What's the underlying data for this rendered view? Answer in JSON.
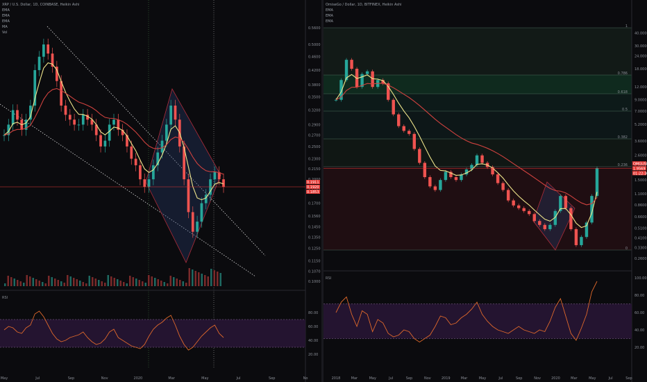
{
  "colors": {
    "background": "#0b0b0e",
    "candle_up": "#26a69a",
    "candle_down": "#ef5350",
    "ema_fast": "#f0e68c",
    "ema_slow": "#d0423f",
    "trend_lines": "#dddddd",
    "rsi_line": "#e0692b",
    "rsi_band": "#241430",
    "price_line": "#e53935"
  },
  "chart_data": [
    {
      "type": "line",
      "title": "XRP / U.S. Dollar, 1D, COINBASE, Heikin Ashi",
      "legend": [
        "EMA",
        "EMA",
        "EMA",
        "MA",
        "Vol"
      ],
      "x_ticks": [
        "May",
        "Jul",
        "Sep",
        "Nov",
        "2020",
        "Mar",
        "May",
        "Jul",
        "Sep",
        "No"
      ],
      "y_ticks": [
        "0.5600",
        "0.5000",
        "0.4600",
        "0.4200",
        "0.3800",
        "0.3500",
        "0.3200",
        "0.2900",
        "0.2700",
        "0.2500",
        "0.2300",
        "0.2150",
        "0.2000",
        "0.1850",
        "0.1700",
        "0.1560",
        "0.1450",
        "0.1350",
        "0.1250",
        "0.1150",
        "0.1070",
        "0.1000"
      ],
      "ylim": [
        0.1,
        0.56
      ],
      "y_scale": "log",
      "price_labels": [
        "0.1911",
        "0.1920",
        "0.1853"
      ],
      "series": [
        {
          "name": "Price",
          "values": [
            0.27,
            0.29,
            0.32,
            0.3,
            0.28,
            0.3,
            0.33,
            0.42,
            0.46,
            0.5,
            0.47,
            0.43,
            0.39,
            0.33,
            0.31,
            0.3,
            0.29,
            0.29,
            0.31,
            0.3,
            0.29,
            0.27,
            0.25,
            0.26,
            0.29,
            0.3,
            0.28,
            0.27,
            0.25,
            0.23,
            0.22,
            0.2,
            0.19,
            0.2,
            0.22,
            0.24,
            0.26,
            0.29,
            0.33,
            0.3,
            0.25,
            0.2,
            0.16,
            0.14,
            0.15,
            0.17,
            0.18,
            0.2,
            0.21,
            0.2,
            0.19
          ]
        }
      ],
      "rsi": {
        "y_ticks": [
          "80.00",
          "60.00",
          "40.00",
          "20.00"
        ],
        "upper": 70,
        "lower": 30,
        "values": [
          55,
          60,
          58,
          52,
          50,
          58,
          62,
          78,
          82,
          74,
          62,
          50,
          42,
          38,
          40,
          44,
          46,
          48,
          52,
          44,
          38,
          34,
          36,
          42,
          52,
          56,
          44,
          40,
          36,
          32,
          30,
          28,
          34,
          46,
          56,
          62,
          66,
          72,
          76,
          62,
          46,
          34,
          26,
          30,
          38,
          46,
          52,
          58,
          62,
          50,
          44
        ]
      }
    },
    {
      "type": "line",
      "title": "OmiseGo / Dollar, 1D, BITFINEX, Heikin Ashi",
      "legend": [
        "EMA",
        "EMA",
        "EMA"
      ],
      "x_ticks": [
        "2018",
        "Mar",
        "May",
        "Jul",
        "Sep",
        "Nov",
        "2019",
        "Mar",
        "May",
        "Jul",
        "Sep",
        "Nov",
        "2020",
        "Mar",
        "May",
        "Jul",
        "Sep"
      ],
      "y_ticks": [
        "40.0000",
        "30.0000",
        "24.0000",
        "18.0000",
        "12.0000",
        "9.0000",
        "7.0000",
        "5.2000",
        "3.6000",
        "2.6000",
        "2.0000",
        "1.5000",
        "1.1000",
        "0.8600",
        "0.6600",
        "0.5100",
        "0.4100",
        "0.3300",
        "0.2600"
      ],
      "ylim": [
        0.23,
        45
      ],
      "y_scale": "log",
      "price_labels": [
        "OMGUSD",
        "1.9569",
        "01:22:30"
      ],
      "fib_levels": [
        "1",
        "0.786",
        "0.618",
        "0.5",
        "0.382",
        "0.236",
        "0"
      ],
      "series": [
        {
          "name": "Price",
          "values": [
            9,
            14,
            22,
            18,
            12,
            16,
            17,
            12,
            14,
            13,
            9,
            6.5,
            5,
            4.5,
            4.2,
            3,
            2.2,
            1.6,
            1.3,
            1.2,
            1.5,
            1.8,
            1.6,
            1.5,
            1.7,
            1.9,
            2.1,
            2.6,
            2.2,
            2,
            1.7,
            1.4,
            1.2,
            0.95,
            0.85,
            0.8,
            0.75,
            0.7,
            0.6,
            0.55,
            0.5,
            0.55,
            0.75,
            1.05,
            0.8,
            0.5,
            0.35,
            0.42,
            0.58,
            1.05,
            1.95
          ]
        }
      ],
      "rsi": {
        "y_ticks": [
          "100.00",
          "80.00",
          "60.00",
          "40.00",
          "20.00"
        ],
        "upper": 70,
        "lower": 30,
        "values": [
          60,
          72,
          78,
          58,
          44,
          62,
          58,
          38,
          52,
          48,
          36,
          32,
          34,
          40,
          38,
          30,
          26,
          30,
          34,
          44,
          56,
          54,
          46,
          48,
          54,
          58,
          64,
          72,
          58,
          50,
          44,
          40,
          38,
          36,
          40,
          44,
          40,
          38,
          36,
          40,
          38,
          50,
          66,
          76,
          56,
          36,
          28,
          42,
          58,
          84,
          96
        ]
      }
    }
  ]
}
